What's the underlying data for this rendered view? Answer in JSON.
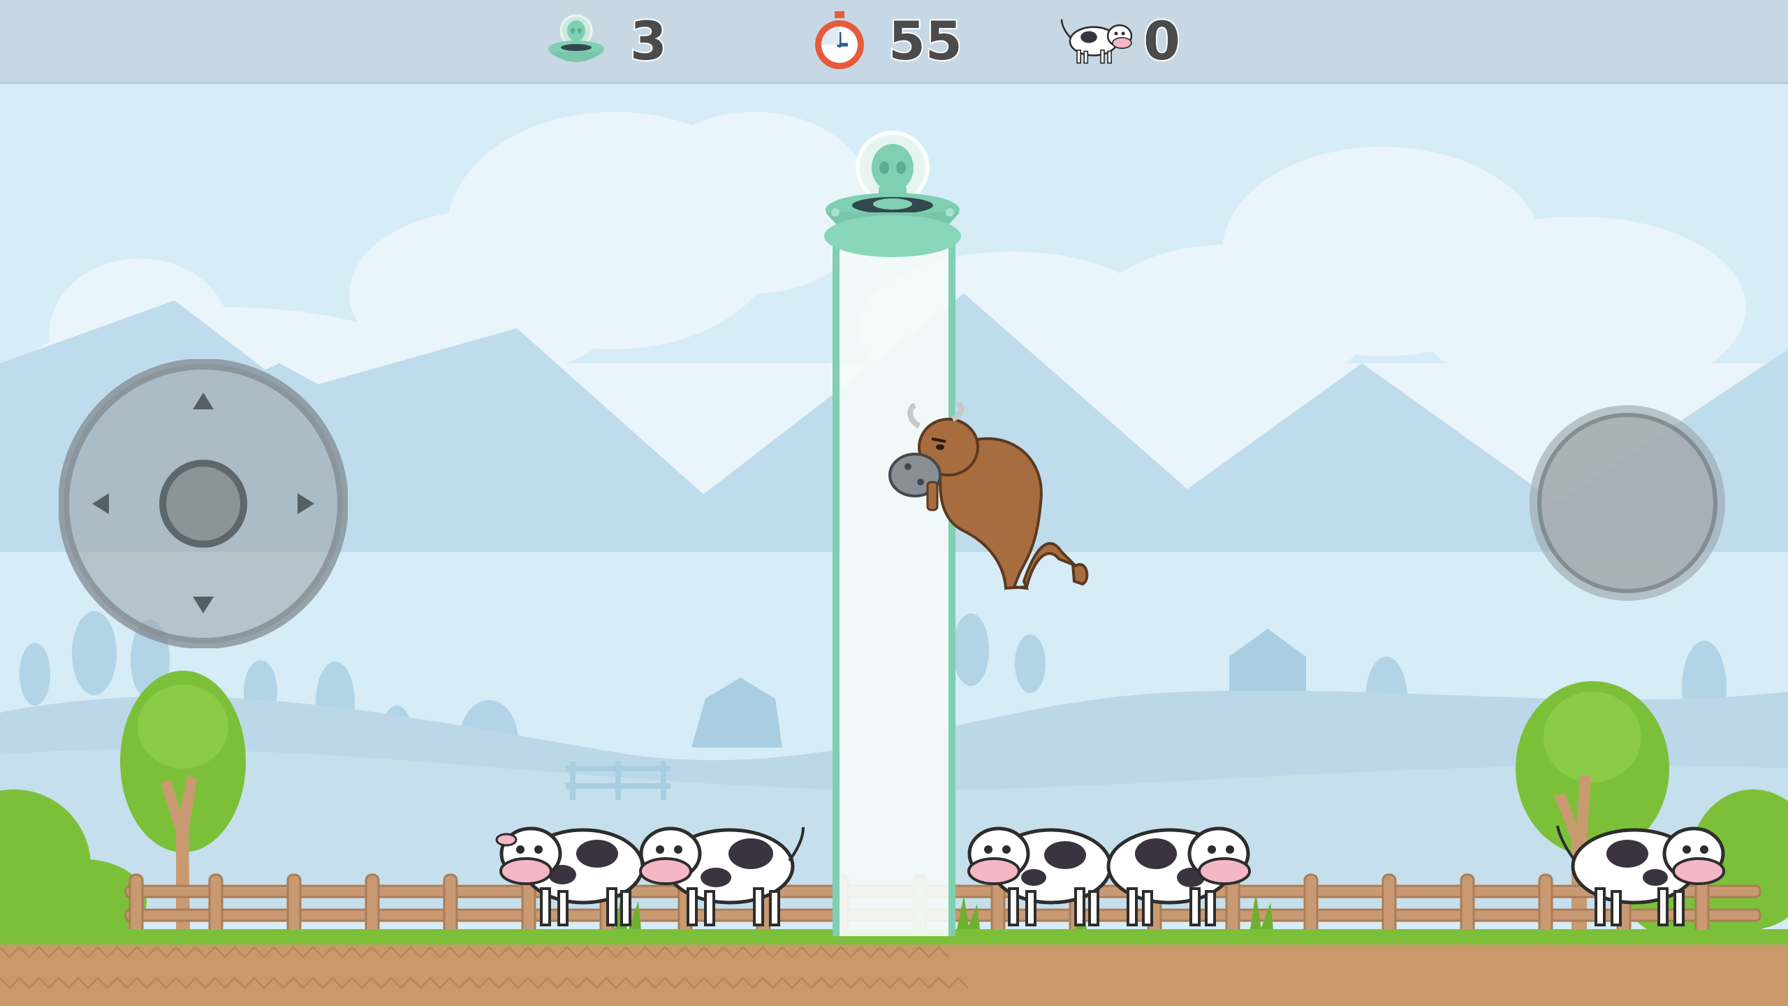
{
  "hud": {
    "lives": {
      "icon": "ufo-icon",
      "value": "3"
    },
    "timer": {
      "icon": "stopwatch-icon",
      "value": "55"
    },
    "cows": {
      "icon": "cow-icon",
      "value": "0"
    }
  },
  "controls": {
    "joystick": {
      "icon": "dpad-icon"
    },
    "action": {
      "icon": "action-button-icon"
    }
  },
  "colors": {
    "sky": "#d6ecf7",
    "hud": "#c7d8e4",
    "ufo": "#7fcfb2",
    "beam": "#f4fbf8",
    "grass": "#7cc03a",
    "dirt": "#c89a6b",
    "fence": "#c99a72"
  }
}
